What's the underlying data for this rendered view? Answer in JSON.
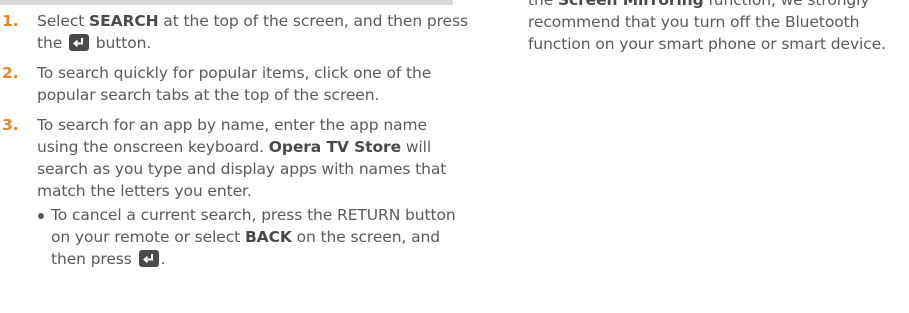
{
  "steps": [
    {
      "num": "1.",
      "t1": "Select ",
      "kw1": "SEARCH",
      "t2": " at the top of the screen, and then press the ",
      "t3": " button."
    },
    {
      "num": "2.",
      "text": "To search quickly for popular items, click one of the popular search tabs at the top of the screen."
    },
    {
      "num": "3.",
      "t1": "To search for an app by name, enter the app name using the onscreen keyboard. ",
      "kw1": "Opera TV Store",
      "t2": " will search as you type and display apps with names that match the letters you enter."
    }
  ],
  "sub": {
    "t1": "To cancel a current search, press the ",
    "kw1": "RETURN",
    "t2": " button on your remote or select ",
    "kw2": "BACK",
    "t3": " on the screen, and then press ",
    "t4": "."
  },
  "right": {
    "t1": "the ",
    "kw1": "Screen Mirroring",
    "t2": " function, we strongly recommend that you turn off the Bluetooth function on your smart phone or smart device."
  },
  "icon": {
    "name": "enter-icon",
    "color": "#4a4a4a"
  }
}
